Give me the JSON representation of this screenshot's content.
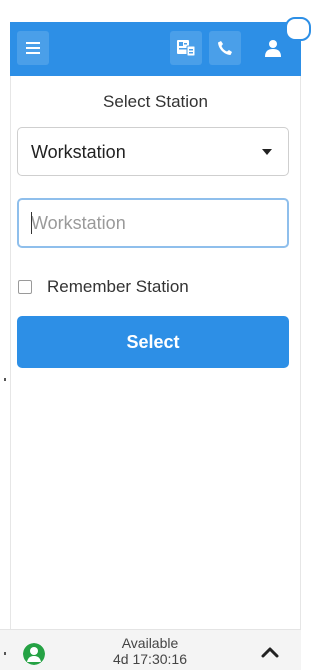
{
  "toolbar": {
    "icons": [
      "hamburger-menu-icon",
      "contacts-icon",
      "phone-icon",
      "user-icon"
    ],
    "accent": "#2d8fe6"
  },
  "station": {
    "title": "Select Station",
    "dropdown_value": "Workstation",
    "input_placeholder": "Workstation",
    "input_value": "",
    "remember_label": "Remember Station",
    "remember_checked": false,
    "select_button": "Select"
  },
  "status": {
    "label": "Available",
    "duration": "4d 17:30:16",
    "indicator_color": "#25a244"
  }
}
